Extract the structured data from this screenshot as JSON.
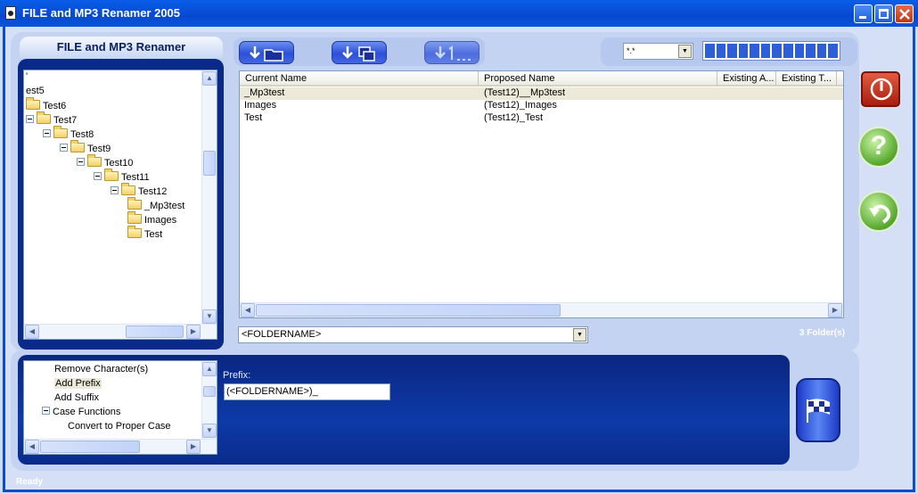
{
  "window": {
    "title": "FILE and MP3 Renamer 2005"
  },
  "sidebar": {
    "header": "FILE and MP3 Renamer",
    "tree": [
      {
        "label": "'",
        "indent": 0,
        "folder": false,
        "expander": false
      },
      {
        "label": "est5",
        "indent": 0,
        "folder": false,
        "expander": false
      },
      {
        "label": "Test6",
        "indent": 0,
        "folder": true,
        "expander": false
      },
      {
        "label": "Test7",
        "indent": 0,
        "folder": true,
        "expander": true
      },
      {
        "label": "Test8",
        "indent": 1,
        "folder": true,
        "expander": true
      },
      {
        "label": "Test9",
        "indent": 2,
        "folder": true,
        "expander": true
      },
      {
        "label": "Test10",
        "indent": 3,
        "folder": true,
        "expander": true
      },
      {
        "label": "Test11",
        "indent": 4,
        "folder": true,
        "expander": true
      },
      {
        "label": "Test12",
        "indent": 5,
        "folder": true,
        "expander": true
      },
      {
        "label": "_Mp3test",
        "indent": 6,
        "folder": true,
        "expander": false
      },
      {
        "label": "Images",
        "indent": 6,
        "folder": true,
        "expander": false
      },
      {
        "label": "Test",
        "indent": 6,
        "folder": true,
        "expander": false
      }
    ]
  },
  "toolbar": {
    "buttons": [
      {
        "name": "open-folder-button",
        "icon": "down-arrow-folder-icon"
      },
      {
        "name": "copy-files-button",
        "icon": "down-arrow-files-icon"
      },
      {
        "name": "numbering-button",
        "icon": "down-arrow-numbering-icon"
      }
    ],
    "filter_value": "*.*",
    "progress_segments": 12,
    "progress_filled": 0
  },
  "file_list": {
    "columns": [
      "Current Name",
      "Proposed Name",
      "Existing A...",
      "Existing T...",
      ""
    ],
    "rows": [
      {
        "current": "_Mp3test",
        "proposed": "(Test12)__Mp3test",
        "selected": true
      },
      {
        "current": "Images",
        "proposed": "(Test12)_Images",
        "selected": false
      },
      {
        "current": "Test",
        "proposed": "(Test12)_Test",
        "selected": false
      }
    ],
    "pattern_value": "<FOLDERNAME>",
    "count_label": "3 Folder(s)"
  },
  "side_buttons": {
    "stop": "power-icon",
    "help": "question-icon",
    "undo": "undo-arrow-icon"
  },
  "functions": {
    "items": [
      {
        "label": "Remove Character(s)",
        "indent": 0,
        "selected": false,
        "expander": false
      },
      {
        "label": "Add Prefix",
        "indent": 0,
        "selected": true,
        "expander": false
      },
      {
        "label": "Add Suffix",
        "indent": 0,
        "selected": false,
        "expander": false
      },
      {
        "label": "Case Functions",
        "indent": 0,
        "selected": false,
        "expander": true
      },
      {
        "label": "Convert to Proper Case",
        "indent": 1,
        "selected": false,
        "expander": false
      }
    ],
    "prefix_label": "Prefix:",
    "prefix_value": "(<FOLDERNAME>)_"
  },
  "status": {
    "text": "Ready"
  },
  "colors": {
    "accent": "#0a4ecf",
    "dark_panel": "#0a2a8a",
    "selection": "#ece9d8"
  }
}
